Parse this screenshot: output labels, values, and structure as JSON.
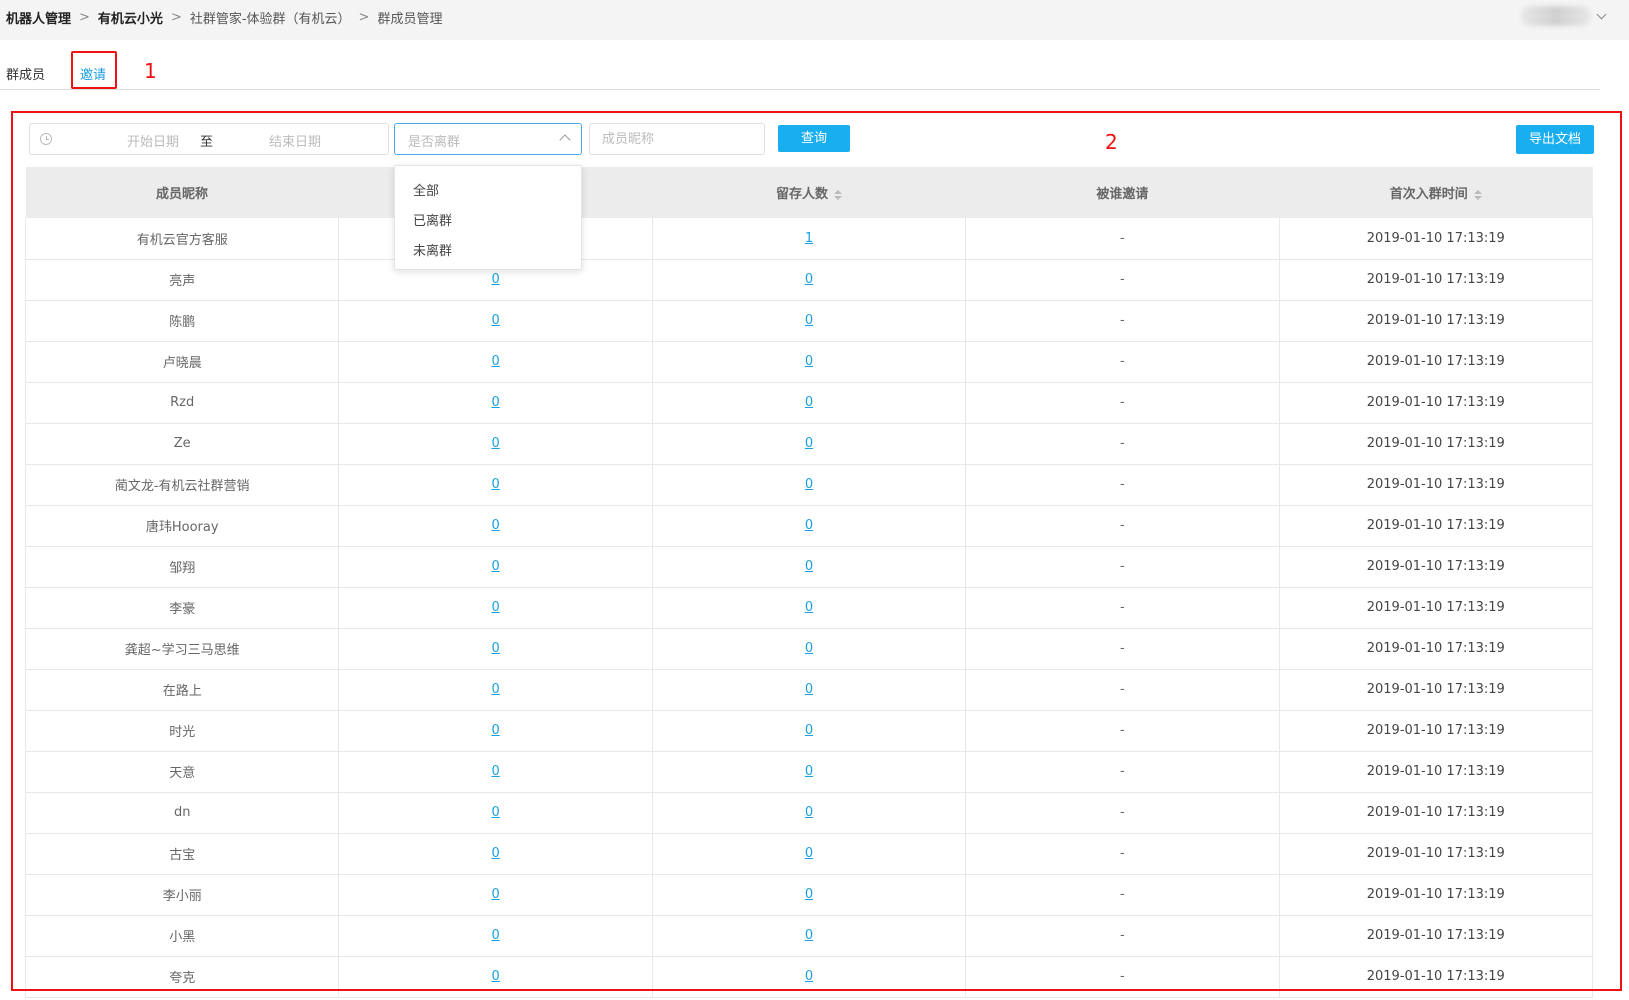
{
  "breadcrumb": {
    "items": [
      "机器人管理",
      "有机云小光",
      "社群管家-体验群（有机云）",
      "群成员管理"
    ],
    "separator": ">"
  },
  "tabs": {
    "members": "群成员",
    "invite": "邀请"
  },
  "annotations": {
    "one": "1",
    "two": "2"
  },
  "filters": {
    "date_start_placeholder": "开始日期",
    "date_separator": "至",
    "date_end_placeholder": "结束日期",
    "left_group_placeholder": "是否离群",
    "nickname_placeholder": "成员昵称",
    "query_label": "查询",
    "export_label": "导出文档"
  },
  "dropdown": {
    "options": [
      "全部",
      "已离群",
      "未离群"
    ]
  },
  "table": {
    "headers": [
      "成员昵称",
      "",
      "留存人数",
      "被谁邀请",
      "首次入群时间"
    ],
    "rows": [
      {
        "name": "有机云官方客服",
        "invited": "",
        "retained": "1",
        "inviter": "-",
        "time": "2019-01-10 17:13:19"
      },
      {
        "name": "亮声",
        "invited": "0",
        "retained": "0",
        "inviter": "-",
        "time": "2019-01-10 17:13:19"
      },
      {
        "name": "陈鹏",
        "invited": "0",
        "retained": "0",
        "inviter": "-",
        "time": "2019-01-10 17:13:19"
      },
      {
        "name": "卢晓晨",
        "invited": "0",
        "retained": "0",
        "inviter": "-",
        "time": "2019-01-10 17:13:19"
      },
      {
        "name": "Rzd",
        "invited": "0",
        "retained": "0",
        "inviter": "-",
        "time": "2019-01-10 17:13:19"
      },
      {
        "name": "Ze",
        "invited": "0",
        "retained": "0",
        "inviter": "-",
        "time": "2019-01-10 17:13:19"
      },
      {
        "name": "蔺文龙-有机云社群营销",
        "invited": "0",
        "retained": "0",
        "inviter": "-",
        "time": "2019-01-10 17:13:19"
      },
      {
        "name": "唐玮Hooray",
        "invited": "0",
        "retained": "0",
        "inviter": "-",
        "time": "2019-01-10 17:13:19"
      },
      {
        "name": "邹翔",
        "invited": "0",
        "retained": "0",
        "inviter": "-",
        "time": "2019-01-10 17:13:19"
      },
      {
        "name": "李豪",
        "invited": "0",
        "retained": "0",
        "inviter": "-",
        "time": "2019-01-10 17:13:19"
      },
      {
        "name": "龚超~学习三马思维",
        "invited": "0",
        "retained": "0",
        "inviter": "-",
        "time": "2019-01-10 17:13:19"
      },
      {
        "name": "在路上",
        "invited": "0",
        "retained": "0",
        "inviter": "-",
        "time": "2019-01-10 17:13:19"
      },
      {
        "name": "时光",
        "invited": "0",
        "retained": "0",
        "inviter": "-",
        "time": "2019-01-10 17:13:19"
      },
      {
        "name": "天意",
        "invited": "0",
        "retained": "0",
        "inviter": "-",
        "time": "2019-01-10 17:13:19"
      },
      {
        "name": "dn",
        "invited": "0",
        "retained": "0",
        "inviter": "-",
        "time": "2019-01-10 17:13:19"
      },
      {
        "name": "古宝",
        "invited": "0",
        "retained": "0",
        "inviter": "-",
        "time": "2019-01-10 17:13:19"
      },
      {
        "name": "李小丽",
        "invited": "0",
        "retained": "0",
        "inviter": "-",
        "time": "2019-01-10 17:13:19"
      },
      {
        "name": "小黑",
        "invited": "0",
        "retained": "0",
        "inviter": "-",
        "time": "2019-01-10 17:13:19"
      },
      {
        "name": "夸克",
        "invited": "0",
        "retained": "0",
        "inviter": "-",
        "time": "2019-01-10 17:13:19"
      }
    ]
  },
  "colors": {
    "accent": "#19aef0",
    "link": "#1a9fe0",
    "annotation": "#ee1111"
  }
}
